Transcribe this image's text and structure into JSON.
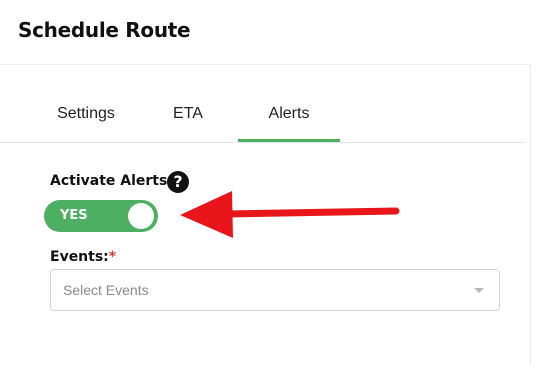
{
  "page": {
    "title": "Schedule Route"
  },
  "tabs": [
    {
      "label": "Settings"
    },
    {
      "label": "ETA"
    },
    {
      "label": "Alerts"
    }
  ],
  "active_tab": "Alerts",
  "alerts": {
    "activate_label": "Activate Alerts",
    "help_icon": "question-circle-icon",
    "toggle_label": "YES",
    "toggle_on": true,
    "events_label": "Events:",
    "events_required_mark": "*",
    "events_placeholder": "Select Events"
  },
  "colors": {
    "accent": "#4caf61",
    "required": "#e53935",
    "annotation_arrow": "#e8161b"
  }
}
